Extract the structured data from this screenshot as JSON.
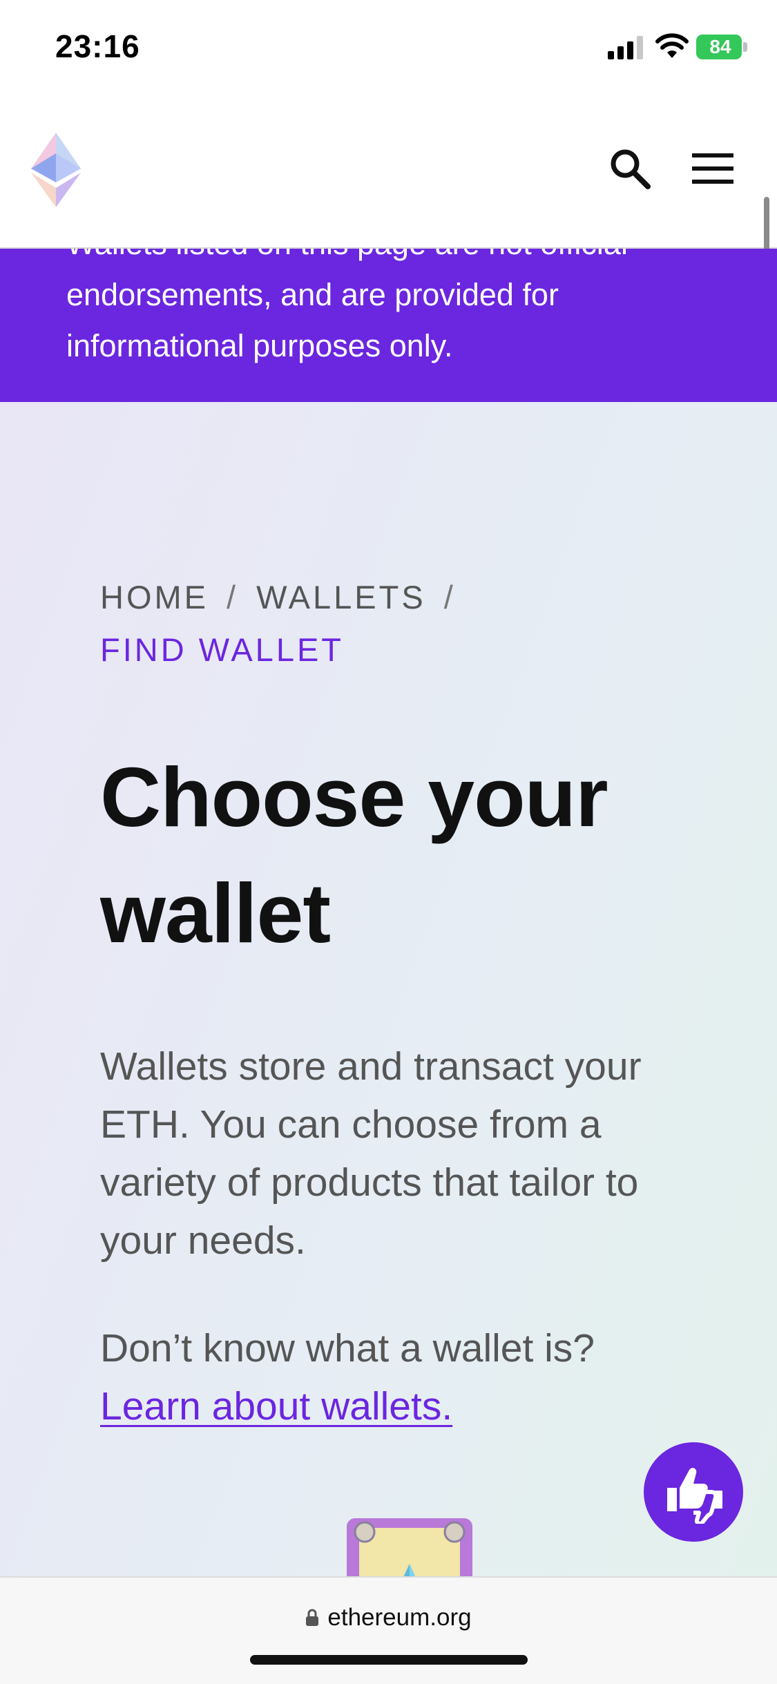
{
  "status_bar": {
    "time": "23:16",
    "battery": "84"
  },
  "header": {
    "logo": "ethereum-diamond-logo",
    "icons": [
      "search-icon",
      "menu-icon"
    ]
  },
  "banner": {
    "text": "Wallets listed on this page are not official endorsements, and are provided for informational purposes only."
  },
  "breadcrumb": {
    "items": [
      "HOME",
      "WALLETS"
    ],
    "separator": "/",
    "current": "FIND WALLET"
  },
  "hero": {
    "title": "Choose your wallet",
    "description": "Wallets store and transact your ETH. You can choose from a variety of products that tailor to your needs.",
    "question": "Don’t know what a wallet is?",
    "link": "Learn about wallets."
  },
  "feedback": {
    "icon": "thumbs-up-down-icon"
  },
  "address_bar": {
    "url": "ethereum.org"
  },
  "colors": {
    "accent": "#6b26df",
    "banner_bg": "#6b26df",
    "text_muted": "#555555"
  }
}
